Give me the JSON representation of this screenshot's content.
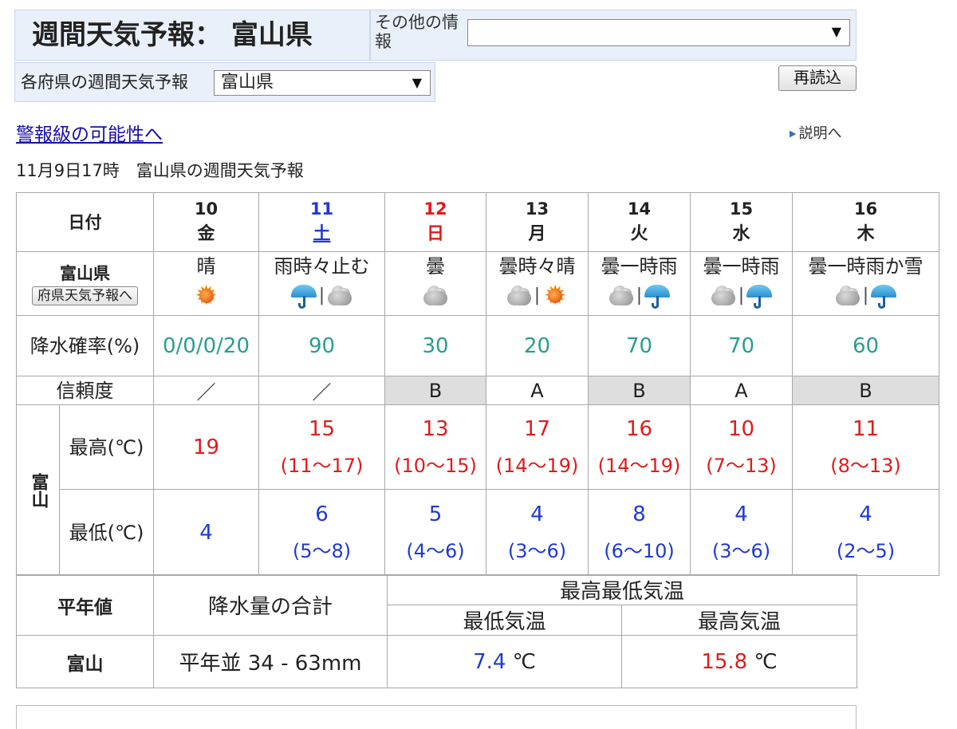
{
  "header": {
    "title": "週間天気予報： 富山県",
    "other_info_label": "その他の情報",
    "other_info_value": "",
    "pref_label": "各府県の週間天気予報",
    "pref_value": "富山県",
    "reload_label": "再読込"
  },
  "links": {
    "warning": "警報級の可能性へ",
    "help": "説明へ"
  },
  "issued": "11月9日17時　富山県の週間天気予報",
  "forecast": {
    "date_header": "日付",
    "region_label": "富山県",
    "pref_button": "府県天気予報へ",
    "pop_label": "降水確率(%)",
    "reliability_label": "信頼度",
    "station": "富山",
    "max_label": "最高(℃)",
    "min_label": "最低(℃)",
    "days": [
      {
        "date": "10",
        "weekday": "金",
        "color": "#222222",
        "weather": "晴",
        "icons": [
          "sun-icon"
        ],
        "pop": "0/0/0/20",
        "reliability": "／",
        "reliability_shaded": false,
        "max": "19",
        "max_range": "",
        "min": "4",
        "min_range": ""
      },
      {
        "date": "11",
        "weekday": "土",
        "color": "#1f3ad1",
        "weather": "雨時々止む",
        "icons": [
          "umbrella-icon",
          "cloud-icon"
        ],
        "pop": "90",
        "reliability": "／",
        "reliability_shaded": false,
        "max": "15",
        "max_range": "(11～17)",
        "min": "6",
        "min_range": "(5～8)"
      },
      {
        "date": "12",
        "weekday": "日",
        "color": "#e01b1b",
        "weather": "曇",
        "icons": [
          "cloud-icon"
        ],
        "pop": "30",
        "reliability": "B",
        "reliability_shaded": true,
        "max": "13",
        "max_range": "(10～15)",
        "min": "5",
        "min_range": "(4～6)"
      },
      {
        "date": "13",
        "weekday": "月",
        "color": "#222222",
        "weather": "曇時々晴",
        "icons": [
          "cloud-icon",
          "sun-icon"
        ],
        "pop": "20",
        "reliability": "A",
        "reliability_shaded": false,
        "max": "17",
        "max_range": "(14～19)",
        "min": "4",
        "min_range": "(3～6)"
      },
      {
        "date": "14",
        "weekday": "火",
        "color": "#222222",
        "weather": "曇一時雨",
        "icons": [
          "cloud-icon",
          "umbrella-icon"
        ],
        "pop": "70",
        "reliability": "B",
        "reliability_shaded": true,
        "max": "16",
        "max_range": "(14～19)",
        "min": "8",
        "min_range": "(6～10)"
      },
      {
        "date": "15",
        "weekday": "水",
        "color": "#222222",
        "weather": "曇一時雨",
        "icons": [
          "cloud-icon",
          "umbrella-icon"
        ],
        "pop": "70",
        "reliability": "A",
        "reliability_shaded": false,
        "max": "10",
        "max_range": "(7～13)",
        "min": "4",
        "min_range": "(3～6)"
      },
      {
        "date": "16",
        "weekday": "木",
        "color": "#222222",
        "weather": "曇一時雨か雪",
        "icons": [
          "cloud-icon",
          "umbrella-icon"
        ],
        "pop": "60",
        "reliability": "B",
        "reliability_shaded": true,
        "max": "11",
        "max_range": "(8～13)",
        "min": "4",
        "min_range": "(2～5)"
      }
    ]
  },
  "normals": {
    "header_label": "平年値",
    "precip_label": "降水量の合計",
    "temp_group_label": "最高最低気温",
    "min_label": "最低気温",
    "max_label": "最高気温",
    "station": "富山",
    "precip_value": "平年並 34 - 63mm",
    "min_value": "7.4",
    "max_value": "15.8",
    "unit": "℃"
  },
  "colors": {
    "header_bg": "#e9f0fa",
    "link": "#1a0dab",
    "temp_high": "#e01b1b",
    "temp_low": "#1f3ad1",
    "pop": "#2a9d8f",
    "shade": "#dedede"
  }
}
